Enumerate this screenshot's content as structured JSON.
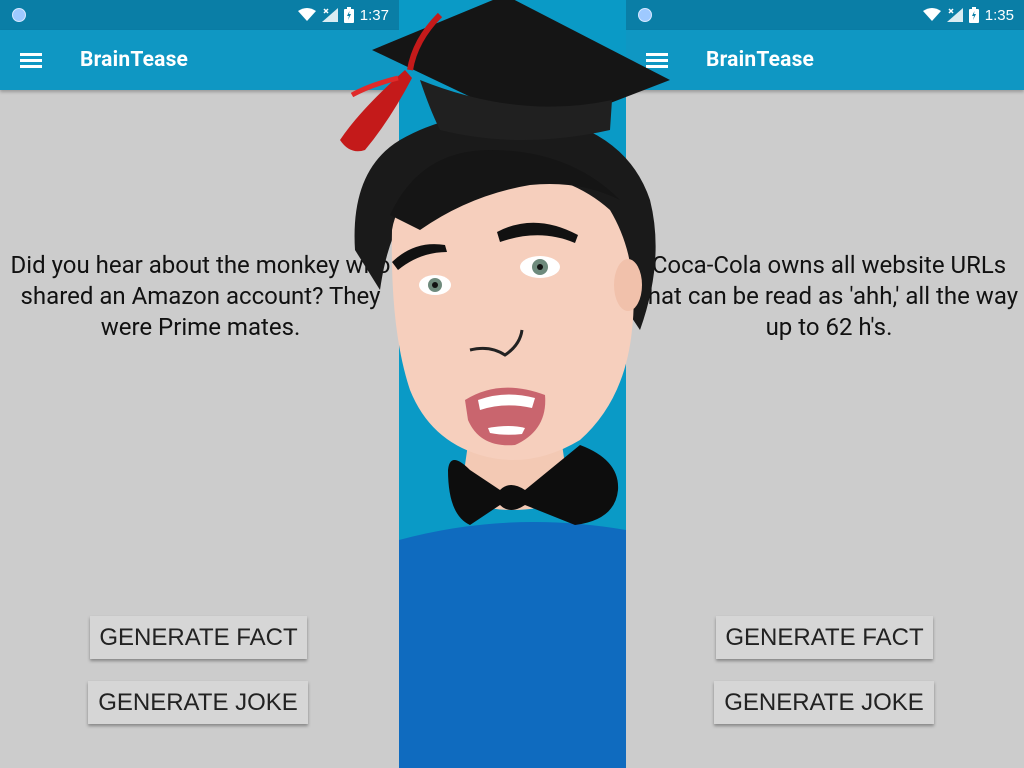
{
  "left_screen": {
    "status": {
      "time": "1:37"
    },
    "app_title": "BrainTease",
    "content": "Did you hear about the monkey who shared an Amazon account? They were Prime mates.",
    "buttons": {
      "fact": "GENERATE FACT",
      "joke": "GENERATE JOKE"
    }
  },
  "right_screen": {
    "status": {
      "time": "1:35"
    },
    "app_title": "BrainTease",
    "content": "Coca-Cola owns all website URLs that can be read as 'ahh,' all the way up to 62 h's.",
    "buttons": {
      "fact": "GENERATE FACT",
      "joke": "GENERATE JOKE"
    }
  },
  "colors": {
    "status_bar": "#0a7ea6",
    "app_bar": "#0f97c3",
    "background": "#cccccc",
    "middle_panel": "#0a9ac6",
    "shirt": "#0f6bbf"
  },
  "icons": [
    "menu-icon",
    "wifi-icon",
    "signal-icon",
    "battery-icon"
  ]
}
